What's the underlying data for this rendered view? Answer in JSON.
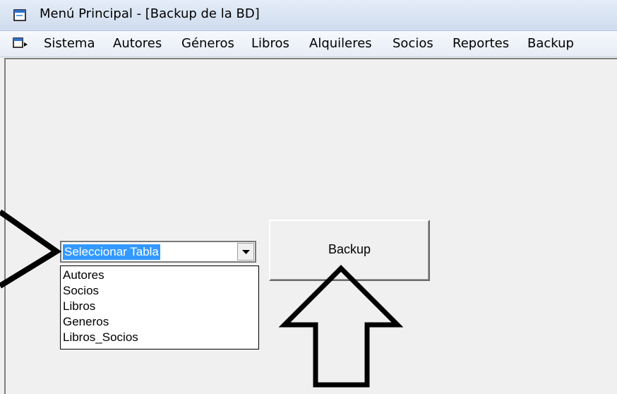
{
  "window": {
    "title": "Menú Principal - [Backup de la BD]"
  },
  "menubar": {
    "items": [
      "Sistema",
      "Autores",
      "Géneros",
      "Libros",
      "Alquileres",
      "Socios",
      "Reportes",
      "Backup"
    ]
  },
  "form": {
    "combo_value": "Seleccionar Tabla",
    "dropdown_options": [
      "Autores",
      "Socios",
      "Libros",
      "Generos",
      "Libros_Socios"
    ],
    "backup_button_label": "Backup"
  },
  "icons": {
    "title": "window-icon",
    "menu": "mdi-child-icon",
    "dropdown": "chevron-down-icon"
  },
  "colors": {
    "selection": "#3399ff",
    "annotation": "#000000"
  }
}
